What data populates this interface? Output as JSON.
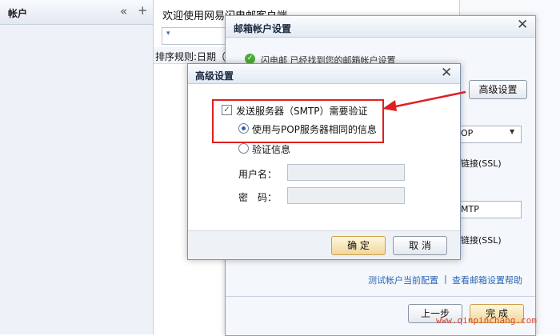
{
  "sidebar": {
    "title": "帐户",
    "collapse_glyph": "«",
    "add_glyph": "+"
  },
  "main": {
    "welcome": "欢迎使用网易闪电邮客户端",
    "dropdown_glyph": "▾",
    "sort_text": "排序规则:日期（"
  },
  "mailbox_dialog": {
    "title": "邮箱帐户设置",
    "close_glyph": "✕",
    "found_text": "闪电邮 已经找到您的邮箱帐户设置",
    "advanced_button": "高级设置",
    "protocol_value": "OP",
    "ssl_label_1": "链接(SSL)",
    "smtp_value": "MTP",
    "ssl_label_2": "链接(SSL)",
    "test_link": "测试帐户当前配置",
    "separator": "|",
    "help_link": "查看邮箱设置帮助",
    "prev_button": "上一步",
    "finish_button": "完 成"
  },
  "advanced_dialog": {
    "title": "高级设置",
    "close_glyph": "✕",
    "smtp_auth_label": "发送服务器（SMTP）需要验证",
    "smtp_auth_checked": true,
    "same_as_pop_label": "使用与POP服务器相同的信息",
    "auth_info_label": "验证信息",
    "username_label": "用户名：",
    "password_label": "密　码：",
    "confirm_button": "确 定",
    "cancel_button": "取 消"
  },
  "watermark": "www.qinpinchang.com",
  "colors": {
    "highlight": "#e02020",
    "link": "#2a66b6",
    "accent_button": "#f0d79a"
  }
}
